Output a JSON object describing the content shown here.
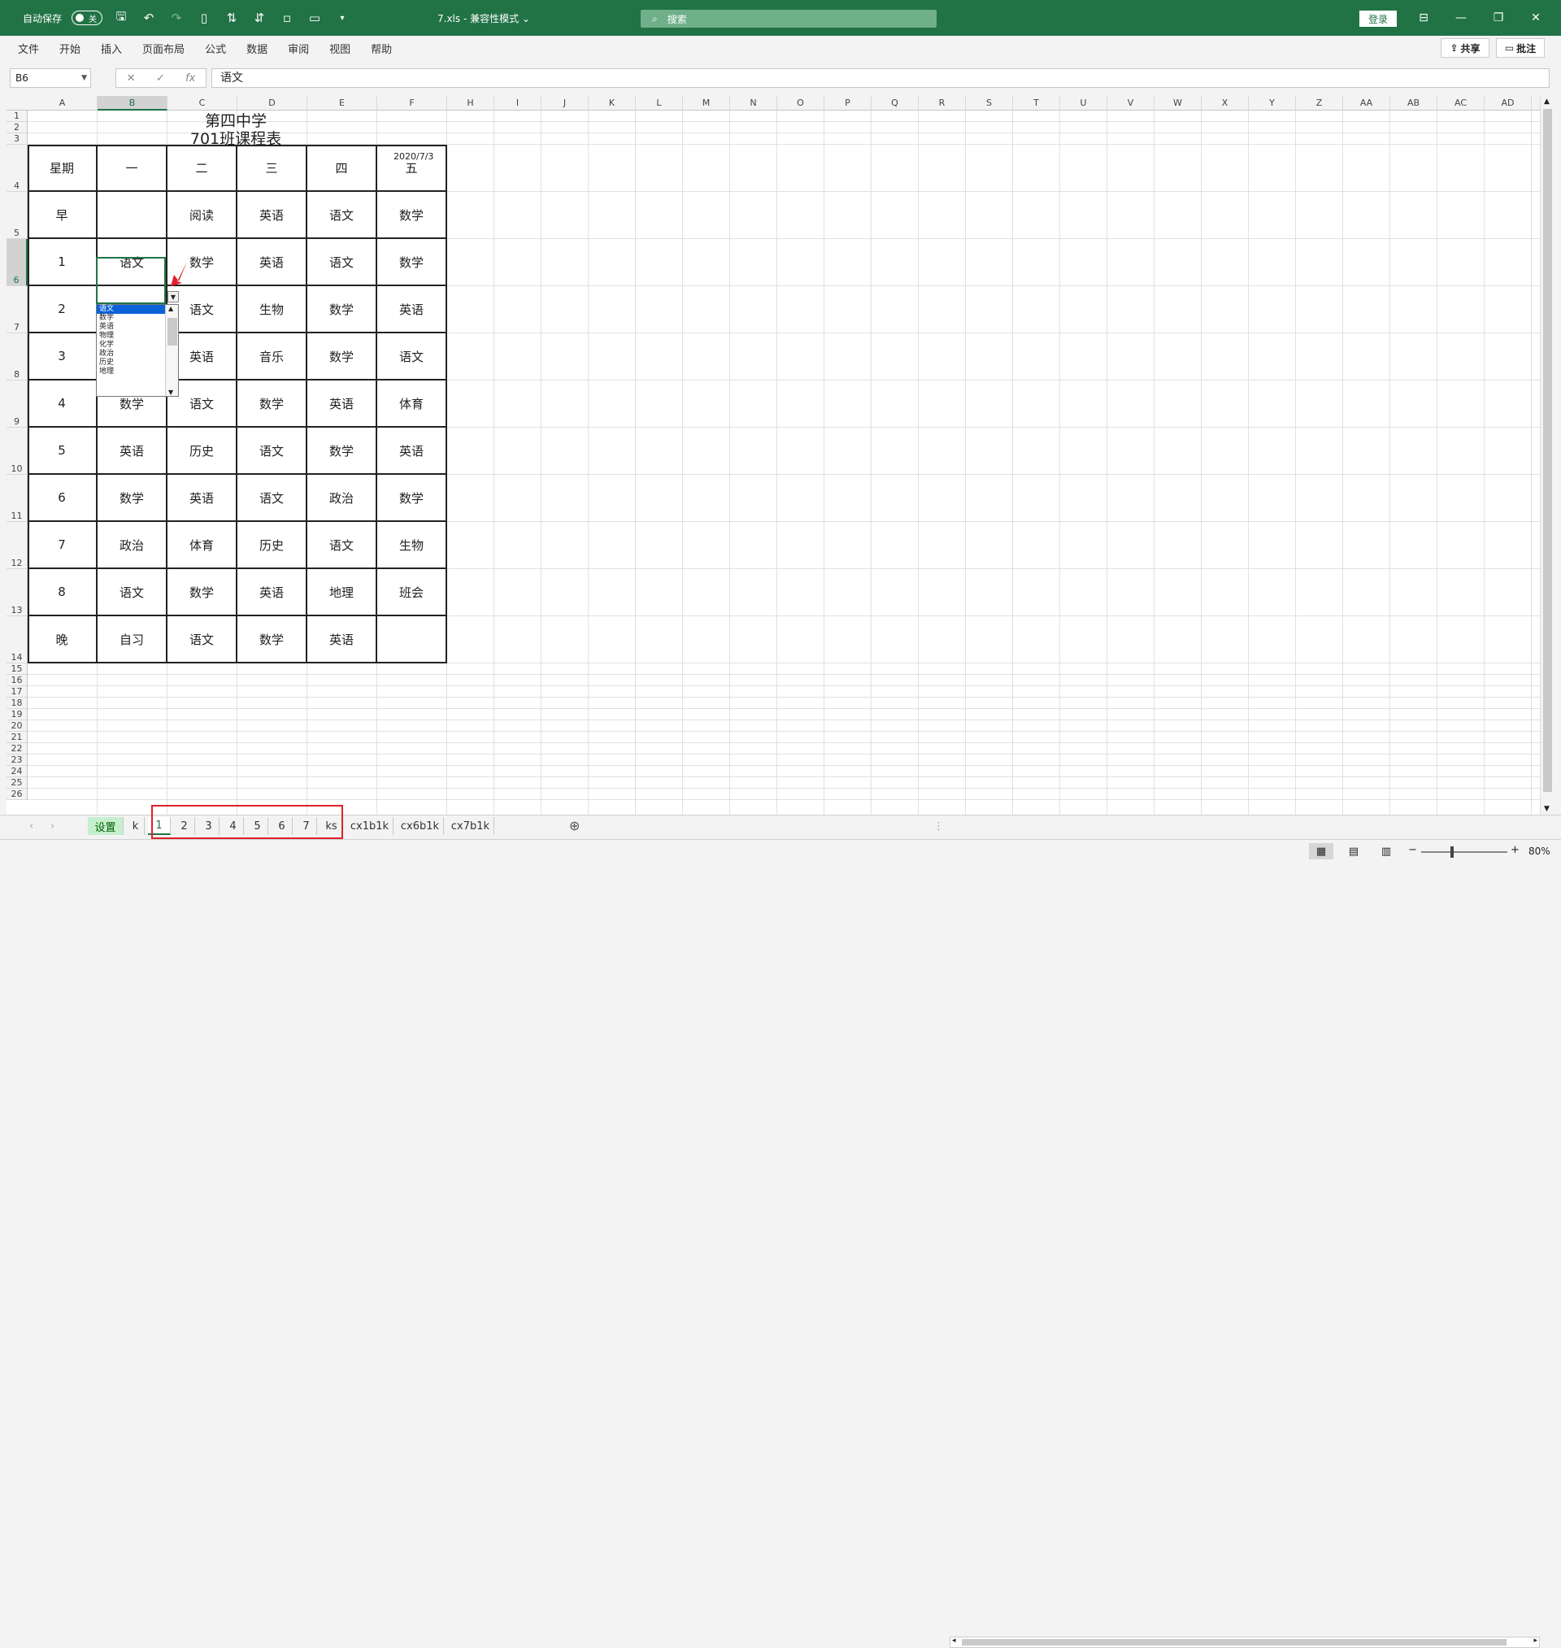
{
  "titlebar": {
    "autosave_label": "自动保存",
    "autosave_state": "关",
    "doc_title": "7.xls  -  兼容性模式  ⌄",
    "search_placeholder": "搜索",
    "login_label": "登录"
  },
  "menu": [
    "文件",
    "开始",
    "插入",
    "页面布局",
    "公式",
    "数据",
    "审阅",
    "视图",
    "帮助"
  ],
  "share_label": "共享",
  "comment_label": "批注",
  "formula": {
    "cell_ref": "B6",
    "fx": "fx",
    "value": "语文"
  },
  "columns": [
    "A",
    "B",
    "C",
    "D",
    "E",
    "F",
    "H",
    "I",
    "J",
    "K",
    "L",
    "M",
    "N",
    "O",
    "P",
    "Q",
    "R",
    "S",
    "T",
    "U",
    "V",
    "W",
    "X",
    "Y",
    "Z",
    "AA",
    "AB",
    "AC",
    "AD"
  ],
  "rows": [
    "1",
    "2",
    "3",
    "4",
    "5",
    "6",
    "7",
    "8",
    "9",
    "10",
    "11",
    "12",
    "13",
    "14",
    "15",
    "16",
    "17",
    "18",
    "19",
    "20",
    "21",
    "22",
    "23",
    "24",
    "25",
    "26"
  ],
  "sheet_title": "第四中学",
  "sheet_subtitle": "701班课程表",
  "date": "2020/7/3",
  "timetable": {
    "header": [
      "星期",
      "一",
      "二",
      "三",
      "四",
      "五"
    ],
    "rows": [
      [
        "早",
        "",
        "阅读",
        "英语",
        "语文",
        "数学"
      ],
      [
        "1",
        "语文",
        "数学",
        "英语",
        "语文",
        "数学"
      ],
      [
        "2",
        "",
        "语文",
        "生物",
        "数学",
        "英语"
      ],
      [
        "3",
        "",
        "英语",
        "音乐",
        "数学",
        "语文"
      ],
      [
        "4",
        "数学",
        "语文",
        "数学",
        "英语",
        "体育"
      ],
      [
        "5",
        "英语",
        "历史",
        "语文",
        "数学",
        "英语"
      ],
      [
        "6",
        "数学",
        "英语",
        "语文",
        "政治",
        "数学"
      ],
      [
        "7",
        "政治",
        "体育",
        "历史",
        "语文",
        "生物"
      ],
      [
        "8",
        "语文",
        "数学",
        "英语",
        "地理",
        "班会"
      ],
      [
        "晚",
        "自习",
        "语文",
        "数学",
        "英语",
        ""
      ]
    ]
  },
  "dropdown_options": [
    "语文",
    "数学",
    "英语",
    "物理",
    "化学",
    "政治",
    "历史",
    "地理"
  ],
  "sheet_tabs": [
    "设置",
    "k",
    "1",
    "2",
    "3",
    "4",
    "5",
    "6",
    "7",
    "ks",
    "cx1b1k",
    "cx6b1k",
    "cx7b1k"
  ],
  "zoom": "80%",
  "colors": {
    "excel_green": "#217346",
    "highlight_box": "#e0202a"
  }
}
